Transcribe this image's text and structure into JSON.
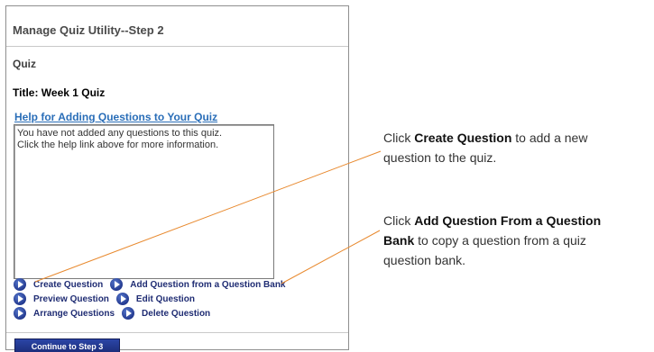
{
  "panel": {
    "title": "Manage Quiz Utility--Step 2",
    "section_label": "Quiz",
    "quiz_title": "Title: Week 1 Quiz",
    "help_link": "Help for Adding Questions to Your Quiz",
    "questions_box_text_line1": "You have not added any questions to this quiz.",
    "questions_box_text_line2": "Click the help link above for more information.",
    "actions": {
      "create_question": "Create Question",
      "add_from_bank": "Add Question from a Question Bank",
      "preview_question": "Preview Question",
      "edit_question": "Edit Question",
      "arrange_questions": "Arrange Questions",
      "delete_question": "Delete Question"
    },
    "continue_button": "Continue to Step 3"
  },
  "callouts": {
    "create": {
      "prefix": "Click ",
      "bold": "Create Question",
      "suffix_line1": " to add a new",
      "line2": "question to the quiz."
    },
    "bank": {
      "prefix": "Click ",
      "bold_line1": "Add Question From a Question",
      "bold_line2": "Bank",
      "suffix_line2": " to copy a question from a quiz",
      "line3": "question bank."
    }
  },
  "colors": {
    "accent_link": "#2a6eb8",
    "action_text": "#1f2c73",
    "button_bg": "#1c2d79",
    "callout_line": "#e8892e",
    "icon": "play-circle-icon"
  }
}
